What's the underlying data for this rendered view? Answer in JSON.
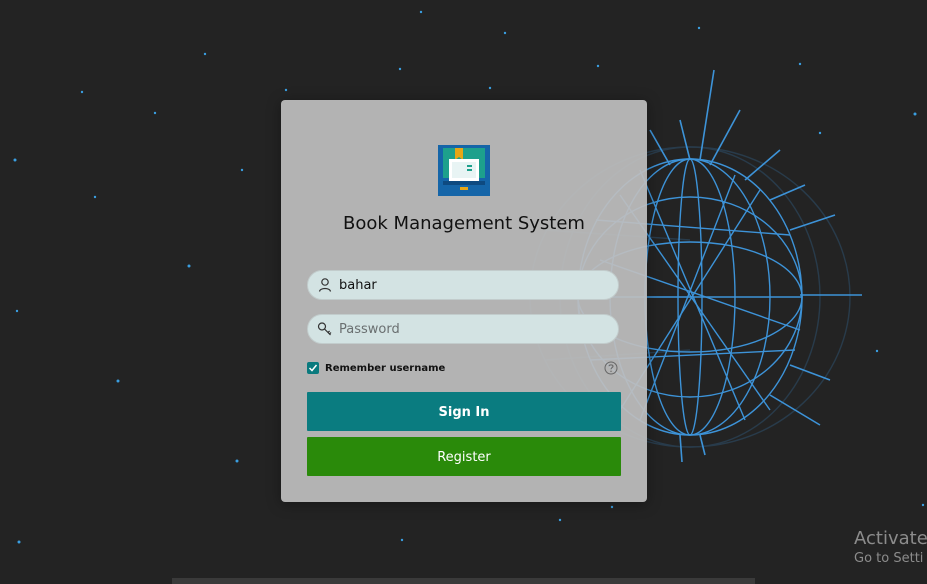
{
  "app": {
    "title": "Book Management System",
    "logo_icon": "book-icon",
    "accent_color": "#0a7c80",
    "register_color": "#2a8a0a"
  },
  "login": {
    "username": {
      "value": "bahar",
      "icon": "user-icon"
    },
    "password": {
      "placeholder": "Password",
      "icon": "key-icon"
    },
    "remember": {
      "label": "Remember username",
      "checked": true
    },
    "help_icon": "help-icon",
    "signin_label": "Sign In",
    "register_label": "Register"
  },
  "watermark": {
    "line1": "Activate",
    "line2": "Go to Setti"
  }
}
